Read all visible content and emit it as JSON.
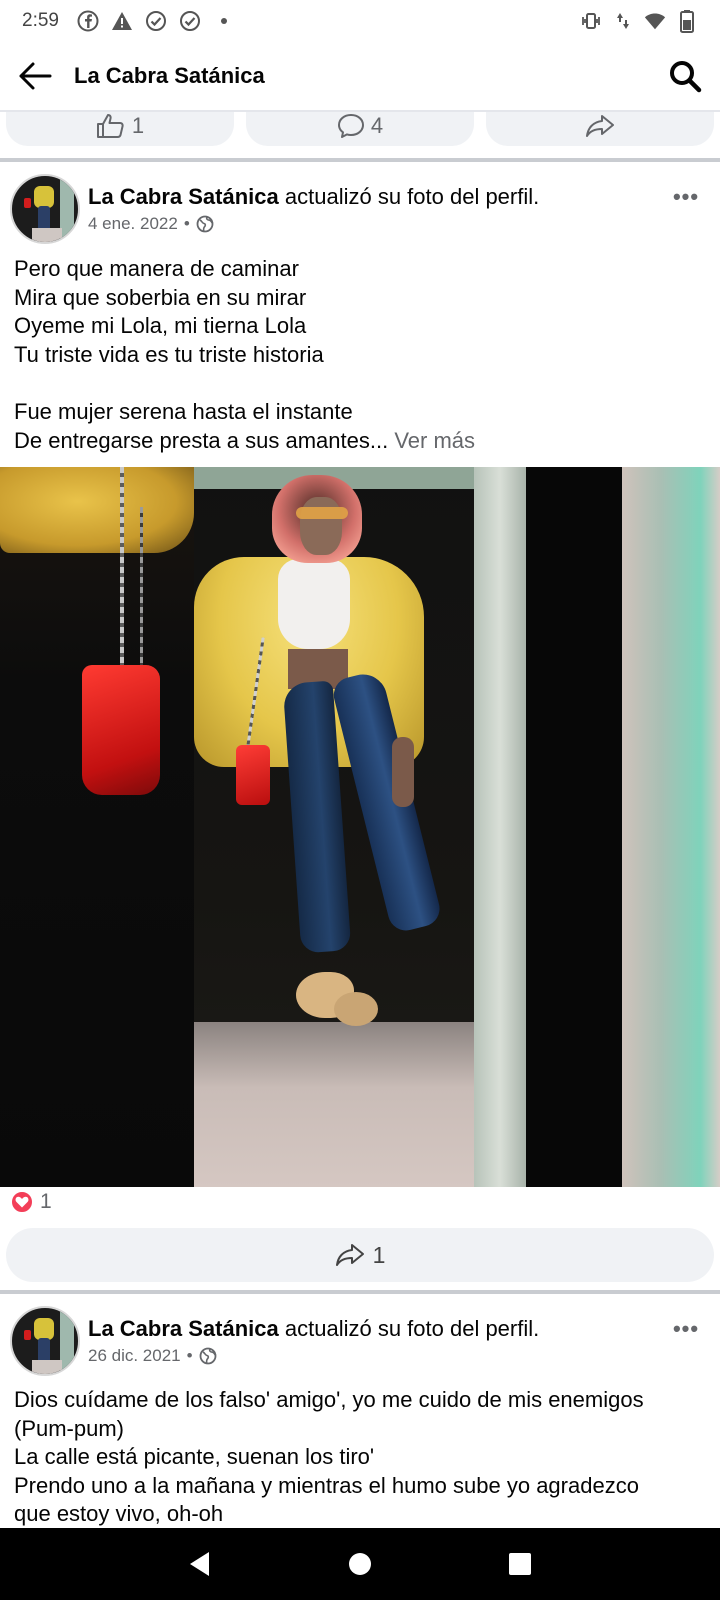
{
  "status_bar": {
    "time": "2:59",
    "left_icons": [
      "facebook-icon",
      "warning-icon",
      "check-circle-icon",
      "check-circle-icon",
      "dot-icon"
    ],
    "right_icons": [
      "vibrate-icon",
      "data-arrows-icon",
      "wifi-icon",
      "battery-icon"
    ]
  },
  "app_bar": {
    "title": "La Cabra Satánica"
  },
  "previous_post_actions": {
    "like_count": "1",
    "comment_count": "4"
  },
  "posts": [
    {
      "author": "La Cabra Satánica",
      "action": "actualizó su foto del perfil.",
      "date": "4 ene. 2022",
      "separator": "•",
      "more": "•••",
      "text_lines": [
        "Pero que manera de caminar",
        "Mira que soberbia en su mirar",
        "Oyeme mi Lola, mi tierna Lola",
        "Tu triste vida es tu triste historia",
        "",
        "Fue mujer serena hasta el instante",
        "De entregarse presta a sus amantes..."
      ],
      "see_more": "Ver más",
      "reaction_count": "1",
      "share_count": "1"
    },
    {
      "author": "La Cabra Satánica",
      "action": "actualizó su foto del perfil.",
      "date": "26 dic. 2021",
      "separator": "•",
      "more": "•••",
      "text_lines": [
        "Dios cuídame de los falso' amigo', yo me cuido de mis enemigos",
        "(Pum-pum)",
        "La calle está picante, suenan los tiro'",
        "Prendo uno a la mañana y mientras el humo sube yo agradezco",
        "que estoy vivo, oh-oh"
      ]
    }
  ],
  "nav_bar": {
    "buttons": [
      "back-nav-icon",
      "home-nav-icon",
      "recents-nav-icon"
    ]
  }
}
